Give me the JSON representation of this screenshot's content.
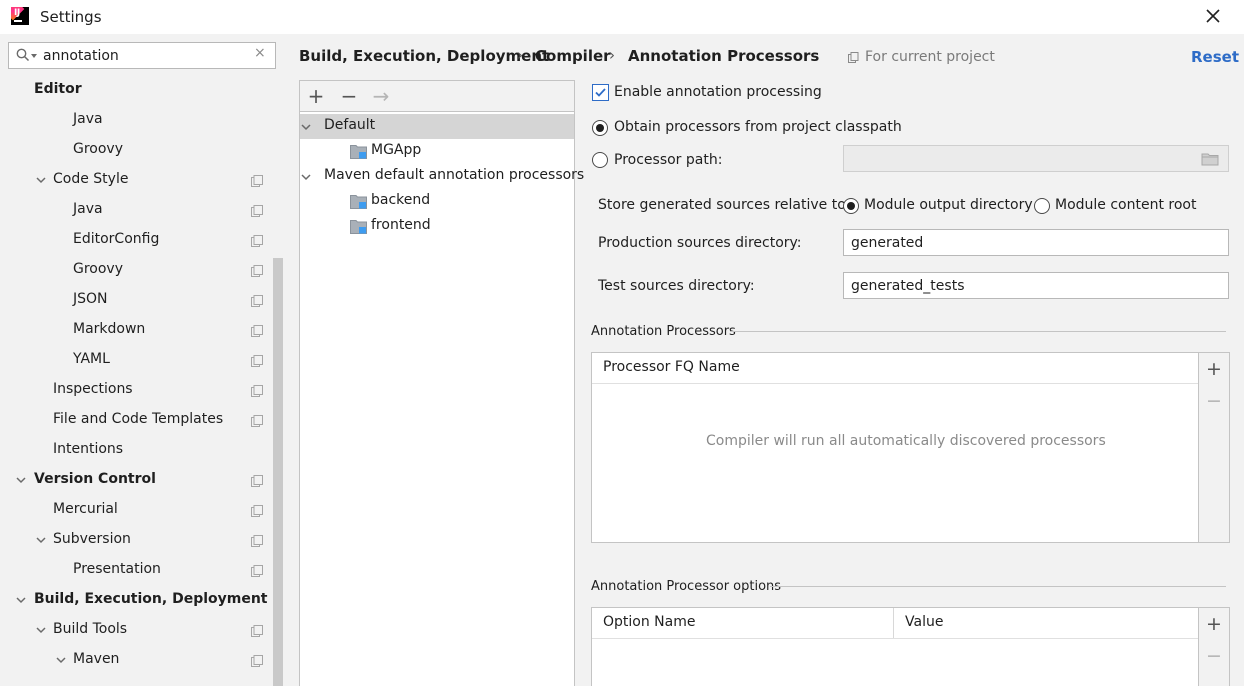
{
  "window": {
    "title": "Settings"
  },
  "search": {
    "value": "annotation",
    "clear": "×"
  },
  "sidebar": {
    "items": [
      {
        "label": "Editor",
        "level": 0,
        "bold": true,
        "chevron": false,
        "copy": false
      },
      {
        "label": "Java",
        "level": 2,
        "bold": false,
        "chevron": false,
        "copy": false
      },
      {
        "label": "Groovy",
        "level": 2,
        "bold": false,
        "chevron": false,
        "copy": false
      },
      {
        "label": "Code Style",
        "level": 1,
        "bold": false,
        "chevron": true,
        "copy": true
      },
      {
        "label": "Java",
        "level": 2,
        "bold": false,
        "chevron": false,
        "copy": true
      },
      {
        "label": "EditorConfig",
        "level": 2,
        "bold": false,
        "chevron": false,
        "copy": true
      },
      {
        "label": "Groovy",
        "level": 2,
        "bold": false,
        "chevron": false,
        "copy": true
      },
      {
        "label": "JSON",
        "level": 2,
        "bold": false,
        "chevron": false,
        "copy": true
      },
      {
        "label": "Markdown",
        "level": 2,
        "bold": false,
        "chevron": false,
        "copy": true
      },
      {
        "label": "YAML",
        "level": 2,
        "bold": false,
        "chevron": false,
        "copy": true
      },
      {
        "label": "Inspections",
        "level": 1,
        "bold": false,
        "chevron": false,
        "copy": true
      },
      {
        "label": "File and Code Templates",
        "level": 1,
        "bold": false,
        "chevron": false,
        "copy": true
      },
      {
        "label": "Intentions",
        "level": 1,
        "bold": false,
        "chevron": false,
        "copy": false
      },
      {
        "label": "Version Control",
        "level": 0,
        "bold": true,
        "chevron": true,
        "copy": true
      },
      {
        "label": "Mercurial",
        "level": 1,
        "bold": false,
        "chevron": false,
        "copy": true
      },
      {
        "label": "Subversion",
        "level": 1,
        "bold": false,
        "chevron": true,
        "copy": true
      },
      {
        "label": "Presentation",
        "level": 2,
        "bold": false,
        "chevron": false,
        "copy": true
      },
      {
        "label": "Build, Execution, Deployment",
        "level": 0,
        "bold": true,
        "chevron": true,
        "copy": false
      },
      {
        "label": "Build Tools",
        "level": 1,
        "bold": false,
        "chevron": true,
        "copy": true
      },
      {
        "label": "Maven",
        "level": 2,
        "bold": false,
        "chevron": true,
        "copy": true
      }
    ]
  },
  "breadcrumb": {
    "items": [
      "Build, Execution, Deployment",
      "Compiler",
      "Annotation Processors"
    ],
    "separator": "›",
    "scope": "For current project",
    "reset": "Reset"
  },
  "profiles": {
    "toolbar": {
      "add": "+",
      "remove": "−",
      "move": "→"
    },
    "tree": [
      {
        "label": "Default",
        "type": "group",
        "selected": true
      },
      {
        "label": "MGApp",
        "type": "module",
        "selected": false
      },
      {
        "label": "Maven default annotation processors",
        "type": "group",
        "selected": false
      },
      {
        "label": "backend",
        "type": "module",
        "selected": false
      },
      {
        "label": "frontend",
        "type": "module",
        "selected": false
      }
    ]
  },
  "settings": {
    "enable_label": "Enable annotation processing",
    "enable_checked": true,
    "obtain_label": "Obtain processors from project classpath",
    "processor_path_label": "Processor path:",
    "processor_path_value": "",
    "store_label": "Store generated sources relative to:",
    "module_output_label": "Module output directory",
    "module_content_label": "Module content root",
    "production_label": "Production sources directory:",
    "production_value": "generated",
    "test_label": "Test sources directory:",
    "test_value": "generated_tests"
  },
  "processors_table": {
    "title": "Annotation Processors",
    "column": "Processor FQ Name",
    "empty": "Compiler will run all automatically discovered processors",
    "add": "+",
    "remove": "−"
  },
  "options_table": {
    "title": "Annotation Processor options",
    "columns": [
      "Option Name",
      "Value"
    ],
    "add": "+",
    "remove": "−"
  }
}
